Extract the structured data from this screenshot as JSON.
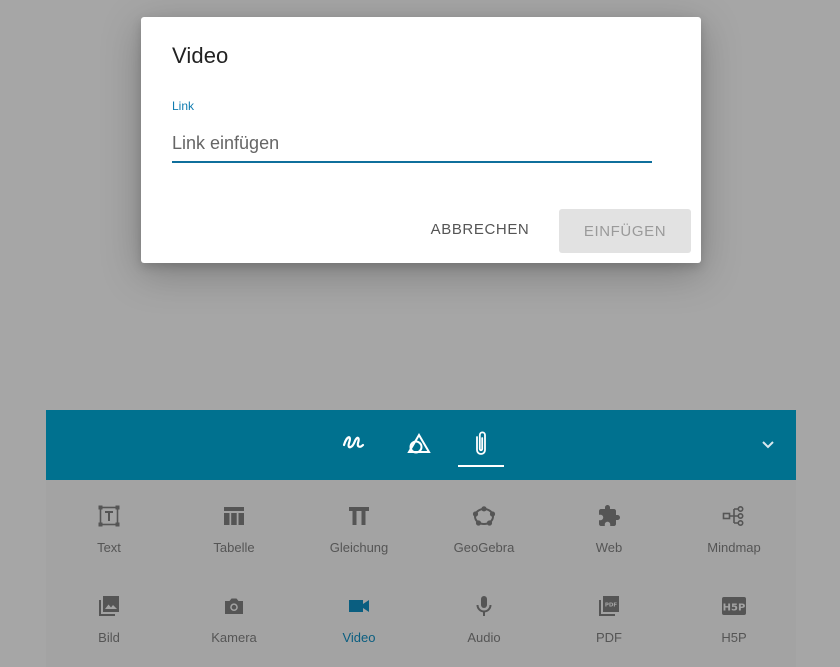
{
  "dialog": {
    "title": "Video",
    "field_label": "Link",
    "placeholder": "Link einfügen",
    "value": "",
    "cancel_label": "ABBRECHEN",
    "insert_label": "EINFÜGEN"
  },
  "toolbar": {
    "header_icons": [
      "draw-icon",
      "shapes-icon",
      "attachment-icon"
    ],
    "active_header": "attachment-icon",
    "colors": {
      "header": "#00718f",
      "active_label": "#0a5e80",
      "accent": "#0e7bb0"
    },
    "tools": [
      {
        "label": "Text",
        "icon": "text-icon"
      },
      {
        "label": "Tabelle",
        "icon": "table-icon"
      },
      {
        "label": "Gleichung",
        "icon": "equation-icon"
      },
      {
        "label": "GeoGebra",
        "icon": "geogebra-icon"
      },
      {
        "label": "Web",
        "icon": "puzzle-icon"
      },
      {
        "label": "Mindmap",
        "icon": "mindmap-icon"
      },
      {
        "label": "Bild",
        "icon": "image-icon"
      },
      {
        "label": "Kamera",
        "icon": "camera-icon"
      },
      {
        "label": "Video",
        "icon": "video-icon"
      },
      {
        "label": "Audio",
        "icon": "microphone-icon"
      },
      {
        "label": "PDF",
        "icon": "pdf-icon"
      },
      {
        "label": "H5P",
        "icon": "h5p-icon"
      }
    ],
    "active_tool": "Video"
  }
}
